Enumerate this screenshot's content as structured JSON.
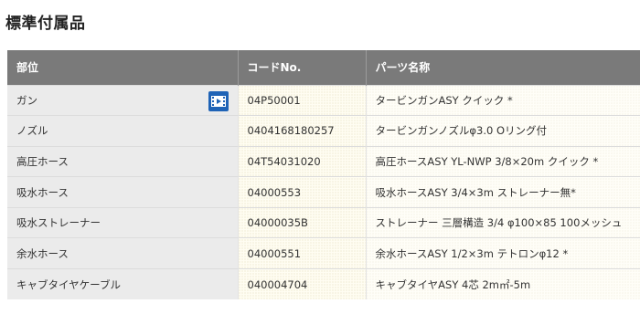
{
  "page": {
    "title": "標準付属品"
  },
  "table": {
    "headers": [
      "部位",
      "コードNo.",
      "パーツ名称"
    ],
    "rows": [
      {
        "part": "ガン",
        "code": "04P50001",
        "name": "タービンガンASY クイック *",
        "icon": "video-icon"
      },
      {
        "part": "ノズル",
        "code": "0404168180257",
        "name": "タービンガンノズルφ3.0 Oリング付"
      },
      {
        "part": "高圧ホース",
        "code": "04T54031020",
        "name": "高圧ホースASY YL-NWP 3/8×20m クイック *"
      },
      {
        "part": "吸水ホース",
        "code": "04000553",
        "name": "吸水ホースASY 3/4×3m ストレーナー無*"
      },
      {
        "part": "吸水ストレーナー",
        "code": "04000035B",
        "name": "ストレーナー 三層構造 3/4 φ100×85 100メッシュ"
      },
      {
        "part": "余水ホース",
        "code": "04000551",
        "name": "余水ホースASY 1/2×3m テトロンφ12 *"
      },
      {
        "part": "キャブタイヤケーブル",
        "code": "040004704",
        "name": "キャブタイヤASY 4芯 2m㎡-5m"
      }
    ]
  },
  "colors": {
    "header_bg": "#7a7a7a",
    "part_col_bg": "#ebebeb",
    "video_button": "#1f63b6"
  }
}
